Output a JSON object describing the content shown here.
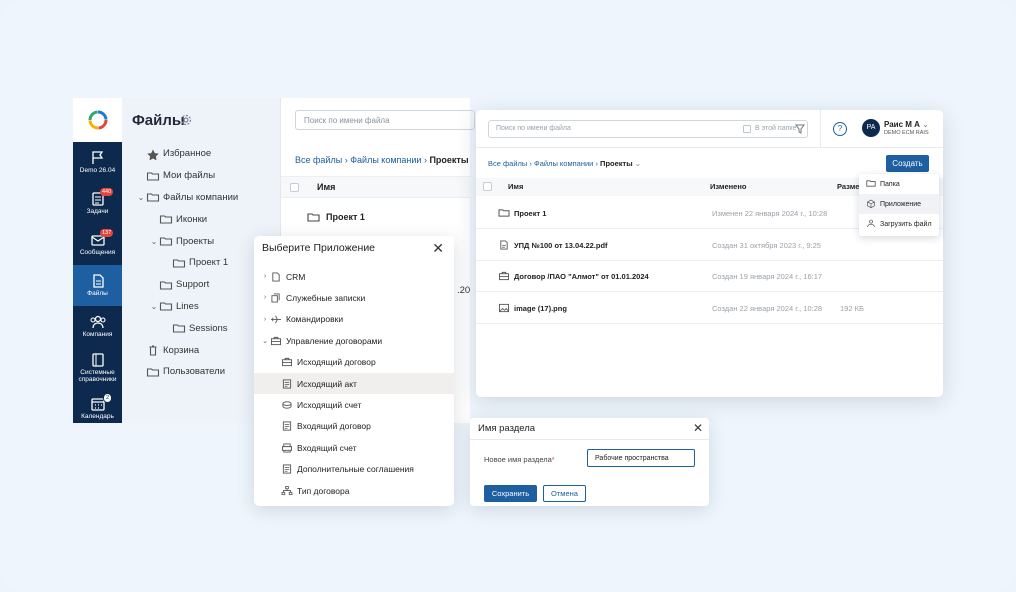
{
  "rail": {
    "items": [
      {
        "label": "Demo 26.04",
        "badge": "",
        "icon": "flag-icon"
      },
      {
        "label": "Задачи",
        "badge": "440",
        "icon": "tasks-icon"
      },
      {
        "label": "Сообщения",
        "badge": "137",
        "icon": "mail-icon"
      },
      {
        "label": "Файлы",
        "badge": "",
        "icon": "file-icon"
      },
      {
        "label": "Компания",
        "badge": "",
        "icon": "people-icon"
      },
      {
        "label": "Системные справочники",
        "badge": "",
        "icon": "book-icon"
      },
      {
        "label": "Календарь",
        "badge": "2",
        "icon": "calendar-icon"
      }
    ]
  },
  "left": {
    "title": "Файлы",
    "tree": [
      {
        "label": "Избранное",
        "indent": 0,
        "chev": "",
        "icon": "star-icon"
      },
      {
        "label": "Мои файлы",
        "indent": 0,
        "chev": "",
        "icon": "folder-icon"
      },
      {
        "label": "Файлы компании",
        "indent": 0,
        "chev": "⌄",
        "icon": "folder-icon"
      },
      {
        "label": "Иконки",
        "indent": 1,
        "chev": "",
        "icon": "folder-icon"
      },
      {
        "label": "Проекты",
        "indent": 1,
        "chev": "⌄",
        "icon": "folder-icon"
      },
      {
        "label": "Проект 1",
        "indent": 2,
        "chev": "",
        "icon": "folder-icon"
      },
      {
        "label": "Support",
        "indent": 1,
        "chev": "",
        "icon": "folder-icon"
      },
      {
        "label": "Lines",
        "indent": 1,
        "chev": "⌄",
        "icon": "folder-icon"
      },
      {
        "label": "Sessions",
        "indent": 2,
        "chev": "",
        "icon": "folder-icon"
      },
      {
        "label": "Корзина",
        "indent": 0,
        "chev": "",
        "icon": "trash-icon"
      },
      {
        "label": "Пользователи",
        "indent": 0,
        "chev": "",
        "icon": "folder-icon"
      }
    ]
  },
  "back": {
    "search_placeholder": "Поиск по имени файла",
    "bc_all": "Все файлы",
    "bc_company": "Файлы компании",
    "bc_current": "Проекты",
    "col_name": "Имя",
    "row1": "Проект 1",
    "partial": ".20"
  },
  "app_modal": {
    "title": "Выберите Приложение",
    "items": [
      {
        "label": "CRM",
        "level": 0,
        "chev": "›",
        "icon": "doc-icon",
        "selected": false
      },
      {
        "label": "Служебные записки",
        "level": 0,
        "chev": "›",
        "icon": "copy-icon",
        "selected": false
      },
      {
        "label": "Командировки",
        "level": 0,
        "chev": "›",
        "icon": "plane-icon",
        "selected": false
      },
      {
        "label": "Управление договорами",
        "level": 0,
        "chev": "⌄",
        "icon": "briefcase-icon",
        "selected": false
      },
      {
        "label": "Исходящий договор",
        "level": 1,
        "chev": "",
        "icon": "briefcase-icon",
        "selected": false
      },
      {
        "label": "Исходящий акт",
        "level": 1,
        "chev": "",
        "icon": "doc-lines-icon",
        "selected": true
      },
      {
        "label": "Исходящий счет",
        "level": 1,
        "chev": "",
        "icon": "coins-icon",
        "selected": false
      },
      {
        "label": "Входящий договор",
        "level": 1,
        "chev": "",
        "icon": "doc-lines-icon",
        "selected": false
      },
      {
        "label": "Входящий счет",
        "level": 1,
        "chev": "",
        "icon": "printer-icon",
        "selected": false
      },
      {
        "label": "Дополнительные соглашения",
        "level": 1,
        "chev": "",
        "icon": "doc-lines-icon",
        "selected": false
      },
      {
        "label": "Тип договора",
        "level": 1,
        "chev": "",
        "icon": "hierarchy-icon",
        "selected": false
      }
    ]
  },
  "window": {
    "search_placeholder": "Поиск по имени файла",
    "in_folder": "В этой папке",
    "user_initials": "PA",
    "user_name": "Раис М А",
    "user_org": "DEMO ECM RAIS",
    "bc_all": "Все файлы",
    "bc_company": "Файлы компании",
    "bc_current": "Проекты",
    "create_label": "Создать",
    "cols": {
      "name": "Имя",
      "changed": "Изменено",
      "size": "Разме"
    },
    "rows": [
      {
        "name": "Проект 1",
        "date": "Изменен 22 января 2024 г., 10:28",
        "size": "",
        "icon": "folder-icon"
      },
      {
        "name": "УПД №100 от 13.04.22.pdf",
        "date": "Создан 31 октября 2023 г., 9:25",
        "size": "",
        "icon": "pdf-icon"
      },
      {
        "name": "Договор /ПАО \"Алмот\" от 01.01.2024",
        "date": "Создан 19 января 2024 г., 16:17",
        "size": "",
        "icon": "briefcase-icon"
      },
      {
        "name": "image (17).png",
        "date": "Создан 22 января 2024 г., 10:28",
        "size": "192 КБ",
        "icon": "image-icon"
      }
    ]
  },
  "dropdown": {
    "items": [
      {
        "label": "Папка",
        "icon": "folder-icon"
      },
      {
        "label": "Приложение",
        "icon": "cube-icon"
      },
      {
        "label": "Загрузить файл",
        "icon": "upload-icon"
      }
    ]
  },
  "section_dialog": {
    "title": "Имя раздела",
    "field_label": "Новое имя раздела",
    "required_mark": "*",
    "field_value": "Рабочие пространства",
    "save_label": "Сохранить",
    "cancel_label": "Отмена"
  }
}
